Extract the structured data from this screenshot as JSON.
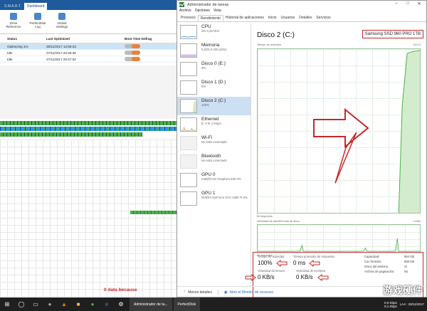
{
  "perfectdisk": {
    "tabs": [
      "S.M.A.R.T.",
      "Dashboard"
    ],
    "tools": [
      {
        "label": "Drive Reference",
        "icon": "drive-icon"
      },
      {
        "label": "PerfectDisk Log",
        "icon": "log-icon"
      },
      {
        "label": "Global Settings",
        "icon": "settings-icon"
      }
    ],
    "columns": [
      "Status",
      "Last Optimized",
      "Boot Time Defrag"
    ],
    "rows": [
      {
        "status": "Optimizing 1%",
        "last": "28/11/2017 12:58:23",
        "toggle": "OFF"
      },
      {
        "status": "Idle",
        "last": "27/11/2017 20:48:35",
        "toggle": "OFF"
      },
      {
        "status": "Idle",
        "last": "27/11/2017 20:47:02",
        "toggle": "OFF"
      }
    ]
  },
  "taskmanager": {
    "title": "Administrador de tareas",
    "menu": [
      "Archivo",
      "Opciones",
      "Vista"
    ],
    "tabs": [
      "Procesos",
      "Rendimiento",
      "Historial de aplicaciones",
      "Inicio",
      "Usuarios",
      "Detalles",
      "Servicios"
    ],
    "active_tab": "Rendimiento",
    "resources": [
      {
        "name": "CPU",
        "sub": "2% 4,29 GHz"
      },
      {
        "name": "Memoria",
        "sub": "5,2/31,9 GB (16%)"
      },
      {
        "name": "Disco 0 (E:)",
        "sub": "0%"
      },
      {
        "name": "Disco 1 (D:)",
        "sub": "0%"
      },
      {
        "name": "Disco 2 (C:)",
        "sub": "100%"
      },
      {
        "name": "Ethernet",
        "sub": "E: 0 R: 0 Kbps"
      },
      {
        "name": "Wi-Fi",
        "sub": "No está conectado"
      },
      {
        "name": "Bluetooth",
        "sub": "No está conectado"
      },
      {
        "name": "GPU 0",
        "sub": "Intel(R) HD Graphics 630 0%"
      },
      {
        "name": "GPU 1",
        "sub": "NVIDIA GeForce GTX 1080 Ti 0%"
      }
    ],
    "disk_title": "Disco 2 (C:)",
    "disk_model": "Samsung SSD 960 PRO 1TB",
    "graph1_label": "Tiempo de actividad",
    "graph1_max": "100 %",
    "graph1_time": "60 segundos",
    "graph2_label": "Velocidad de transferencia de disco",
    "graph2_max": "1 KB/s",
    "graph2_time": "60 segundos",
    "stats": {
      "active_label": "Tiempo de actividad",
      "active_value": "100%",
      "resp_label": "Tiempo promedio de respuesta",
      "resp_value": "0 ms",
      "read_label": "Velocidad de lectura",
      "read_value": "0 KB/s",
      "write_label": "Velocidad de escritura",
      "write_value": "0 KB/s",
      "capacity_label": "Capacidad:",
      "capacity_value": "954 GB",
      "formatted_label": "Con formato:",
      "formatted_value": "858 GB",
      "system_label": "Disco del sistema:",
      "system_value": "Sí",
      "paging_label": "Archivo de paginación:",
      "paging_value": "No"
    },
    "footer_less": "Menos detalles",
    "footer_monitor": "Abrir el Monitor de recursos",
    "annotation": "0 data because"
  },
  "taskbar": {
    "apps": [
      "Administrador de ta...",
      "PerfectDisk"
    ],
    "net_up": "0,0 Kbps",
    "net_down": "0,1 Kbps",
    "clock": "LAA : 28/11/2017"
  },
  "watermark": "游戏硬件"
}
